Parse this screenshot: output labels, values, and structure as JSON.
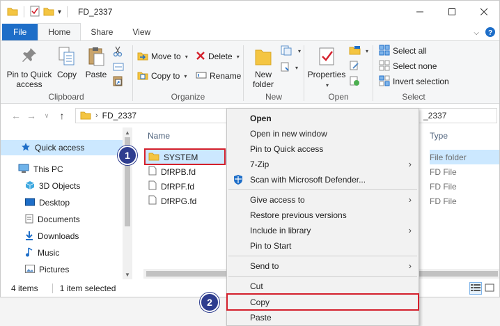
{
  "window": {
    "title": "FD_2337"
  },
  "colors": {
    "file_tab": "#1e6ec8",
    "selection": "#cce8ff",
    "highlight": "#d4202c",
    "badge": "#2e3d8f",
    "folder": "#f4c542"
  },
  "tabs": [
    "File",
    "Home",
    "Share",
    "View"
  ],
  "ribbon": {
    "clipboard": {
      "pin": "Pin to Quick",
      "pin2": "access",
      "copy": "Copy",
      "paste": "Paste",
      "label": "Clipboard"
    },
    "organize": {
      "move_to": "Move to",
      "copy_to": "Copy to",
      "delete": "Delete",
      "rename": "Rename",
      "label": "Organize"
    },
    "new": {
      "new_folder": "New",
      "new_folder2": "folder",
      "label": "New"
    },
    "open": {
      "properties": "Properties",
      "label": "Open"
    },
    "select": {
      "select_all": "Select all",
      "select_none": "Select none",
      "invert": "Invert selection",
      "label": "Select"
    }
  },
  "address": {
    "path": "FD_2337",
    "path_right": "_2337"
  },
  "nav": {
    "items": [
      {
        "label": "Quick access",
        "icon": "star-icon"
      },
      {
        "label": "This PC",
        "icon": "pc-icon"
      },
      {
        "label": "3D Objects",
        "icon": "cube-icon"
      },
      {
        "label": "Desktop",
        "icon": "desktop-icon"
      },
      {
        "label": "Documents",
        "icon": "document-icon"
      },
      {
        "label": "Downloads",
        "icon": "download-icon"
      },
      {
        "label": "Music",
        "icon": "music-icon"
      },
      {
        "label": "Pictures",
        "icon": "picture-icon"
      }
    ]
  },
  "files": {
    "col_name": "Name",
    "col_type": "Type",
    "rows": [
      {
        "name": "SYSTEM",
        "type": "File folder",
        "kind": "folder"
      },
      {
        "name": "DfRPB.fd",
        "type": "FD File",
        "kind": "file"
      },
      {
        "name": "DfRPF.fd",
        "type": "FD File",
        "kind": "file"
      },
      {
        "name": "DfRPG.fd",
        "type": "FD File",
        "kind": "file"
      }
    ]
  },
  "status": {
    "count": "4 items",
    "selected": "1 item selected"
  },
  "menu": {
    "items": [
      "Open",
      "Open in new window",
      "Pin to Quick access",
      "7-Zip",
      "Scan with Microsoft Defender...",
      "Give access to",
      "Restore previous versions",
      "Include in library",
      "Pin to Start",
      "Send to",
      "Cut",
      "Copy",
      "Paste"
    ]
  },
  "badges": [
    "1",
    "2"
  ]
}
